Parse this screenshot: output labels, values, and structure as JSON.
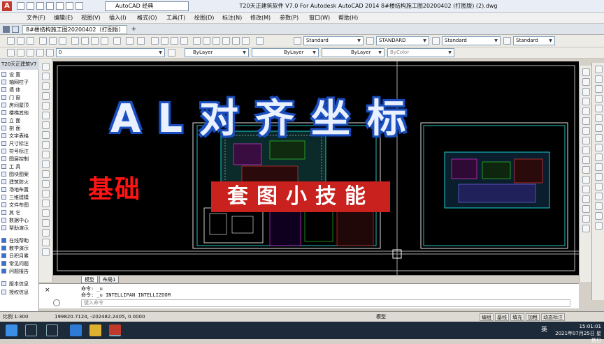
{
  "titlebar": {
    "workspace": "AutoCAD 经典",
    "title": "T20天正建筑软件 V7.0 For Autodesk AutoCAD 2014    8#楼结构施工图20200402 (打图版) (2).dwg",
    "app_icon": "A"
  },
  "menu": [
    "文件(F)",
    "编辑(E)",
    "视图(V)",
    "插入(I)",
    "格式(O)",
    "工具(T)",
    "绘图(D)",
    "标注(N)",
    "修改(M)",
    "参数(P)",
    "窗口(W)",
    "帮助(H)"
  ],
  "doc_tab": "8#楼结构施工图20200402（打图版）(2)*",
  "toolbar2": {
    "text_style": "Standard",
    "dim_style": "STANDARD",
    "table_style": "Standard",
    "mleader_style": "Standard"
  },
  "toolbar3": {
    "layer": "0",
    "color": "ByLayer",
    "linetype": "ByLayer",
    "lineweight": "ByLayer",
    "plotstyle": "ByColor"
  },
  "left_panel": {
    "header": "T20天正建筑V7",
    "items": [
      "设  置",
      "轴网柱子",
      "墙  体",
      "门  窗",
      "房间屋顶",
      "楼梯其他",
      "立  面",
      "剖  面",
      "文字表格",
      "尺寸标注",
      "符号标注",
      "图层控制",
      "工  具",
      "图块图案",
      "建筑防火",
      "场地布置",
      "三维建模",
      "文件布图",
      "其  它",
      "数据中心",
      "帮助演示"
    ],
    "help_items": [
      "在线帮助",
      "教学演示",
      "日积月累",
      "常见问题",
      "问题报告"
    ],
    "footer_items": [
      "版本信息",
      "授权信息"
    ]
  },
  "overlay": {
    "title": "AL对齐坐标",
    "subtitle": "套图小技能",
    "side_label": "基础"
  },
  "layout_tabs": [
    "模型",
    "布局1"
  ],
  "command": {
    "line1": "命令: _u",
    "line2": "命令: _u INTELLIPAN INTELLIZOOM",
    "prompt": "键入命令"
  },
  "status": {
    "scale": "比例 1:300",
    "coords": "199820.7124, -202482.2405, 0.0000",
    "model": "模型",
    "buttons": [
      "编组",
      "基线",
      "填充",
      "加粗",
      "动态标注"
    ]
  },
  "tray": {
    "ime": "英",
    "time": "15:01:01",
    "date": "2021年07月25日 星期日"
  },
  "colors": {
    "canvas": "#000000",
    "overlay_blue": "#1b4fbf",
    "overlay_red": "#c9211e",
    "taskbar": "#1d2a3a"
  }
}
